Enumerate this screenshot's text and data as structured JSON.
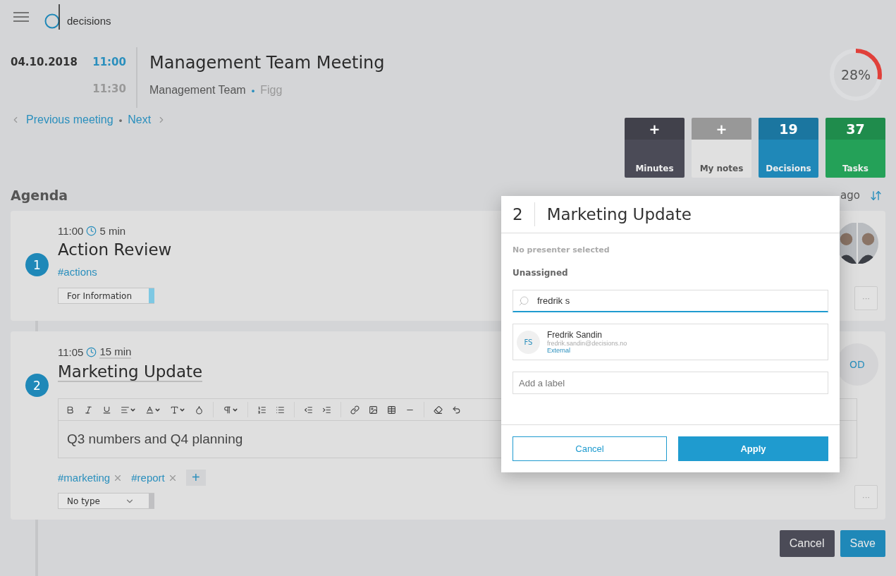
{
  "header": {
    "logo_text": "decisions"
  },
  "meeting": {
    "date": "04.10.2018",
    "start": "11:00",
    "end": "11:30",
    "title": "Management Team Meeting",
    "team": "Management Team",
    "separator": "•",
    "location": "Figg",
    "progress": {
      "level": 0.28,
      "label": "28%"
    }
  },
  "navigation": {
    "previous": "Previous meeting",
    "separator": "•",
    "next": "Next"
  },
  "tiles": [
    {
      "value": "+",
      "label": "Minutes",
      "color": "#4b4b57"
    },
    {
      "value": "+",
      "label": "My notes",
      "color": "#e0e0e0"
    },
    {
      "value": "19",
      "label": "Decisions",
      "color": "#1f88b8"
    },
    {
      "value": "37",
      "label": "Tasks",
      "color": "#24a158"
    }
  ],
  "agenda": {
    "heading": "Agenda",
    "last_update": "ago",
    "items": [
      {
        "number": "1",
        "time": "11:00",
        "duration": "5 min",
        "title": "Action Review",
        "editing": false,
        "tags": [
          {
            "label": "#actions",
            "removable": false
          }
        ],
        "type": {
          "label": "For Information",
          "color": "#7ec8e3",
          "dropdown": false
        },
        "presenters": {
          "kind": "photos"
        },
        "more": "···"
      },
      {
        "number": "2",
        "time": "11:05",
        "duration": "15 min",
        "title": "Marketing Update",
        "editing": true,
        "body": "Q3 numbers and Q4 planning",
        "tags": [
          {
            "label": "#marketing",
            "removable": true
          },
          {
            "label": "#report",
            "removable": true
          }
        ],
        "add_tag": "+",
        "type": {
          "label": "No type",
          "color": "#c0c0c2",
          "dropdown": true
        },
        "presenters": {
          "kind": "initials",
          "initials": "OD"
        },
        "more": "···"
      }
    ]
  },
  "footer": {
    "cancel": "Cancel",
    "save": "Save"
  },
  "dialog": {
    "number": "2",
    "title": "Marketing Update",
    "presenter_note": "No presenter selected",
    "assignment": "Unassigned",
    "search": {
      "value": "fredrik s"
    },
    "results": [
      {
        "initials": "FS",
        "name": "Fredrik Sandin",
        "email": "fredrik.sandin@decisions.no",
        "badge": "External"
      }
    ],
    "label_field": {
      "placeholder": "Add a label"
    },
    "cancel": "Cancel",
    "apply": "Apply"
  }
}
